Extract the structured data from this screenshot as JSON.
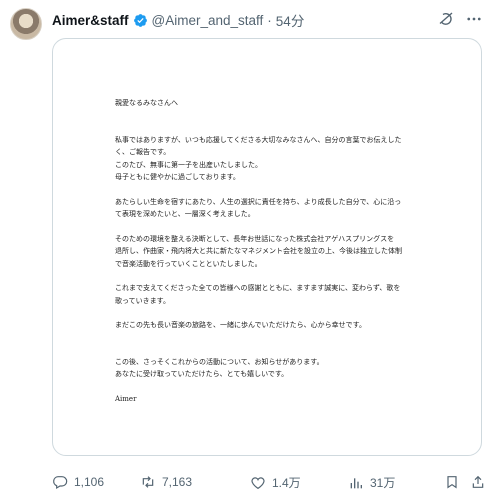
{
  "tweet": {
    "display_name": "Aimer&staff",
    "handle": "@Aimer_and_staff",
    "separator": "·",
    "time": "54分"
  },
  "letter": {
    "greeting": "親愛なるみなさんへ",
    "para1": [
      "私事ではありますが、いつも応援してくださる大切なみなさんへ、自分の言葉でお伝えした",
      "く、ご報告です。",
      "このたび、無事に第一子を出産いたしました。",
      "母子ともに健やかに過ごしております。"
    ],
    "para2": [
      "あたらしい生命を宿すにあたり、人生の選択に責任を持ち、より成長した自分で、心に沿っ",
      "て表現を深めたいと、一層深く考えました。"
    ],
    "para3": [
      "そのための環境を整える決断として、長年お世話になった株式会社アゲハスプリングスを",
      "退所し、作曲家・飛内将大と共に新たなマネジメント会社を設立の上、今後は独立した体制",
      "で音楽活動を行っていくことといたしました。"
    ],
    "para4": [
      "これまで支えてくださった全ての皆様への感謝とともに、ますます誠実に、変わらず、歌を",
      "歌っていきます。"
    ],
    "para5": [
      "まだこの先も長い音楽の旅路を、一緒に歩んでいただけたら、心から幸せです。"
    ],
    "para6": [
      "この後、さっそくこれからの活動について、お知らせがあります。",
      "あなたに受け取っていただけたら、とても嬉しいです。"
    ],
    "signature": "Aimer"
  },
  "actions": {
    "replies": "1,106",
    "reposts": "7,163",
    "likes": "1.4万",
    "views": "31万"
  },
  "colors": {
    "text": "#0f1419",
    "secondary": "#536471",
    "verified": "#1d9bf0",
    "border": "#cfd9de"
  }
}
